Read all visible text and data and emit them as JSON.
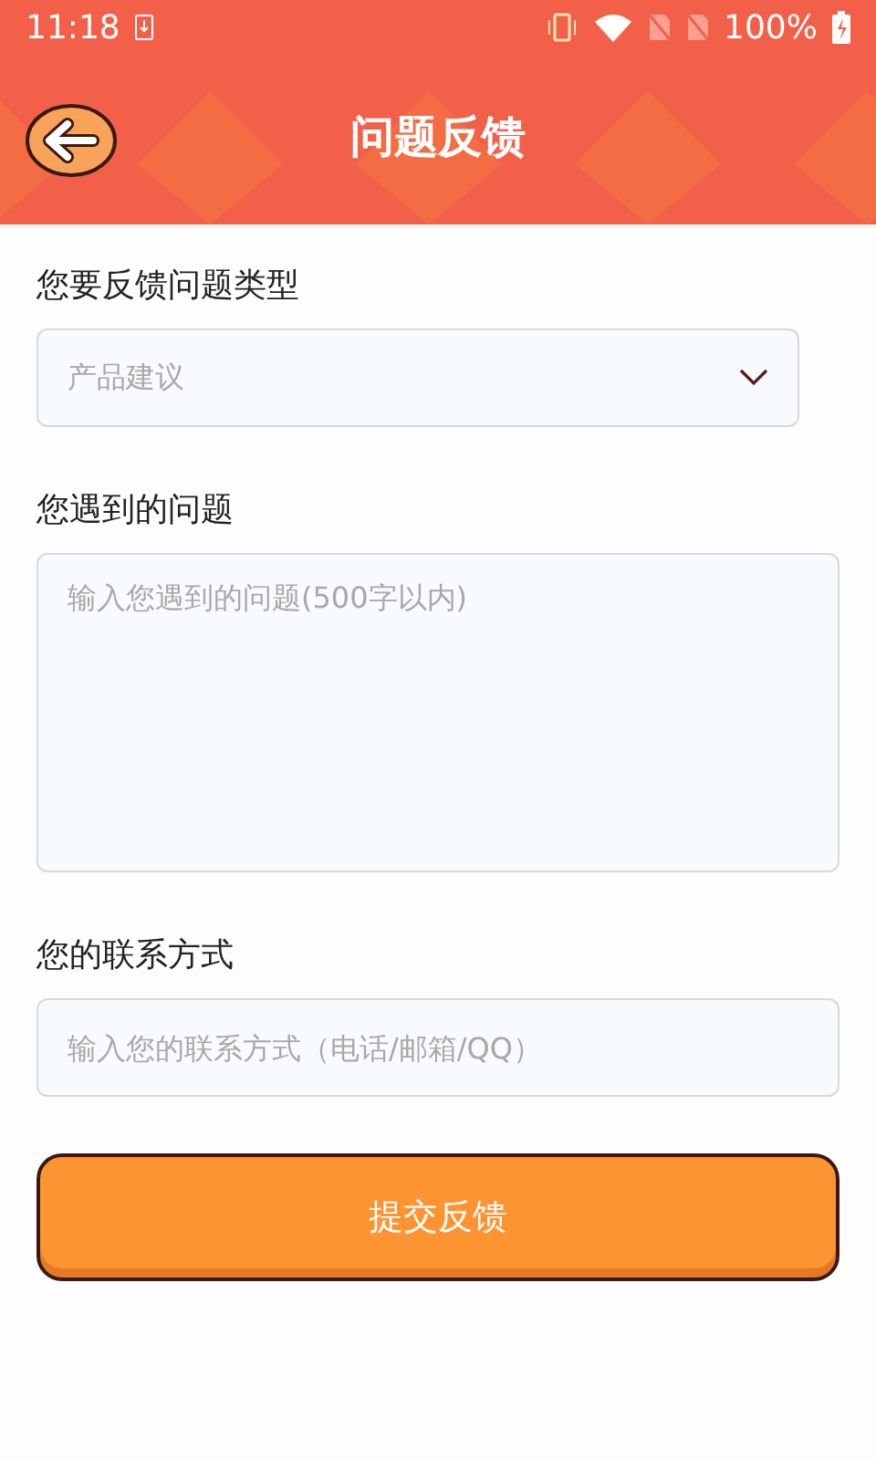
{
  "status_bar": {
    "time": "11:18",
    "battery": "100%"
  },
  "header": {
    "title": "问题反馈"
  },
  "fields": [
    {
      "kind": "select",
      "label": "您要反馈问题类型",
      "value": "产品建议"
    },
    {
      "kind": "textarea",
      "label": "您遇到的问题",
      "placeholder": "输入您遇到的问题(500字以内)"
    },
    {
      "kind": "input",
      "label": "您的联系方式",
      "placeholder": "输入您的联系方式（电话/邮箱/QQ）"
    }
  ],
  "submit_button": "提交反馈"
}
